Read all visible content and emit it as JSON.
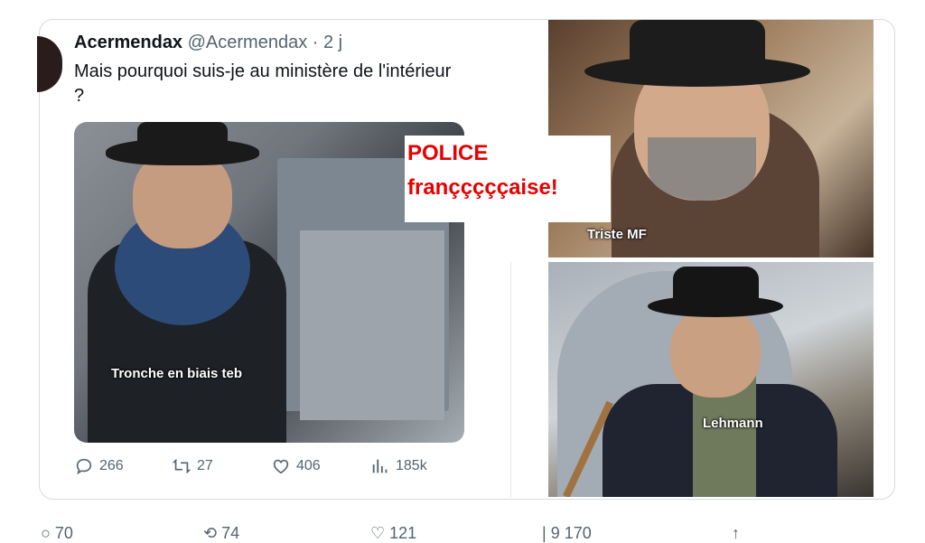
{
  "tweet": {
    "display_name": "Acermendax",
    "handle": "@Acermendax",
    "time": "· 2 j",
    "text": "Mais pourquoi suis-je au ministère de l'intérieur ?",
    "stats": {
      "replies": "266",
      "retweets": "27",
      "likes": "406",
      "views": "185k"
    }
  },
  "overlay": {
    "police_line1": "POLICE",
    "police_line2": "françççççaise!",
    "caption_left": "Tronche en biais teb",
    "caption_top_right": "Triste MF",
    "caption_bottom_right": "Lehmann"
  },
  "bottom_stats": {
    "replies": "70",
    "retweets": "74",
    "likes": "121",
    "views": "9 170"
  },
  "colors": {
    "accent_red": "#e60000",
    "text_primary": "#0f1419",
    "text_secondary": "#536471"
  }
}
